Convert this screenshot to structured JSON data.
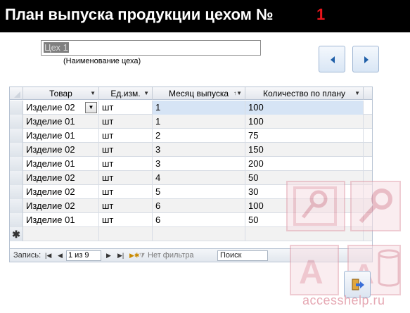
{
  "header": {
    "title": "План выпуска продукции цехом №",
    "number": "1"
  },
  "workshop": {
    "value": "Цех 1",
    "caption": "(Наименование цеха)"
  },
  "navigation": {
    "prev_icon": "triangle-left-icon",
    "next_icon": "triangle-right-icon"
  },
  "grid": {
    "columns": [
      "Товар",
      "Ед.изм.",
      "Месяц выпуска",
      "Количество по плану"
    ],
    "rows": [
      [
        "Изделие 02",
        "шт",
        "1",
        "100"
      ],
      [
        "Изделие 01",
        "шт",
        "1",
        "100"
      ],
      [
        "Изделие 01",
        "шт",
        "2",
        "75"
      ],
      [
        "Изделие 02",
        "шт",
        "3",
        "150"
      ],
      [
        "Изделие 01",
        "шт",
        "3",
        "200"
      ],
      [
        "Изделие 02",
        "шт",
        "4",
        "50"
      ],
      [
        "Изделие 02",
        "шт",
        "5",
        "30"
      ],
      [
        "Изделие 02",
        "шт",
        "6",
        "100"
      ],
      [
        "Изделие 01",
        "шт",
        "6",
        "50"
      ]
    ],
    "new_row_marker": "✱"
  },
  "statusbar": {
    "record_label": "Запись:",
    "record_value": "1 из 9",
    "filter_label": "Нет фильтра",
    "search_label": "Поиск"
  },
  "watermark": {
    "text": "accesshelp.ru"
  },
  "colors": {
    "title_bg": "#000000",
    "title_number": "#e8141b",
    "watermark": "#e6a9b4"
  }
}
